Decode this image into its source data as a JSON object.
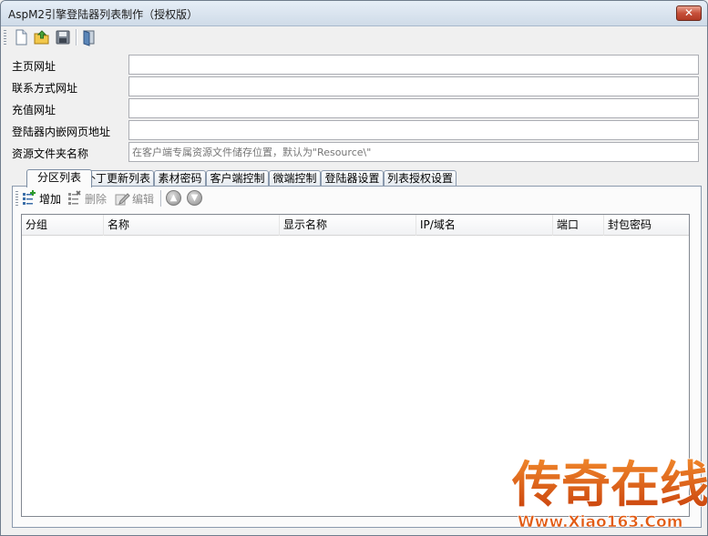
{
  "window": {
    "title": "AspM2引擎登陆器列表制作（授权版）",
    "close_glyph": "✕"
  },
  "toolbar": {
    "buttons": [
      {
        "name": "new-file-icon"
      },
      {
        "name": "open-folder-icon"
      },
      {
        "name": "save-icon"
      },
      {
        "name": "exit-icon"
      }
    ]
  },
  "form": {
    "homepage": {
      "label": "主页网址",
      "value": ""
    },
    "contact": {
      "label": "联系方式网址",
      "value": ""
    },
    "recharge": {
      "label": "充值网址",
      "value": ""
    },
    "embedded": {
      "label": "登陆器内嵌网页地址",
      "value": ""
    },
    "resource": {
      "label": "资源文件夹名称",
      "value": "",
      "placeholder": "在客户端专属资源文件储存位置，默认为\"Resource\\\""
    }
  },
  "tabs": [
    {
      "label": "分区列表",
      "active": true
    },
    {
      "label": "补丁更新列表"
    },
    {
      "label": "素材密码"
    },
    {
      "label": "客户端控制"
    },
    {
      "label": "微端控制"
    },
    {
      "label": "登陆器设置"
    },
    {
      "label": "列表授权设置"
    }
  ],
  "subtoolbar": {
    "add_label": "增加",
    "delete_label": "删除",
    "edit_label": "编辑"
  },
  "list": {
    "columns": [
      "分组",
      "名称",
      "显示名称",
      "IP/域名",
      "端口",
      "封包密码"
    ],
    "rows": []
  },
  "watermark": {
    "logo_text": "传奇在线",
    "url": "Www.Xiao163.Com"
  },
  "colors": {
    "accent": "#3a77c4",
    "watermark_orange": "#e25a12"
  }
}
